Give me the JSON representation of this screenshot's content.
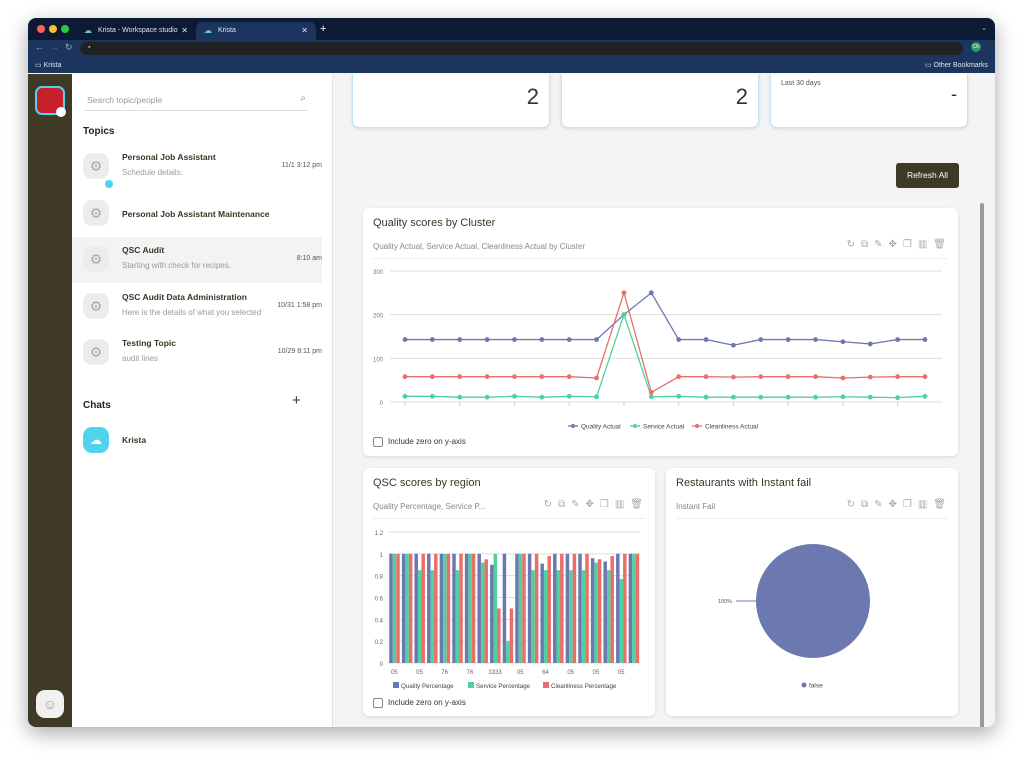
{
  "browser": {
    "tabs": [
      {
        "label": "Krista - Workspace studio"
      },
      {
        "label": "Krista"
      }
    ],
    "bookmark": "Krista",
    "other_bookmarks": "Other Bookmarks",
    "profile": "CK"
  },
  "sidebar": {
    "search_placeholder": "Search topic/people",
    "topics_heading": "Topics",
    "chats_heading": "Chats",
    "topics": [
      {
        "title": "Personal Job Assistant",
        "subtitle": "Schedule details:",
        "time": "11/1 3:12 pm",
        "unread": true
      },
      {
        "title": "Personal Job Assistant Maintenance",
        "subtitle": "",
        "time": ""
      },
      {
        "title": "QSC Audit",
        "subtitle": "Starting with check for recipes.",
        "time": "8:10 am",
        "selected": true
      },
      {
        "title": "QSC Audit Data Administration",
        "subtitle": "Here is the details of what you selected",
        "time": "10/31 1:58 pm"
      },
      {
        "title": "Testing Topic",
        "subtitle": "audit lines",
        "time": "10/29 8:11 pm"
      }
    ],
    "chats": [
      {
        "name": "Krista"
      }
    ]
  },
  "stats": [
    {
      "value": "2"
    },
    {
      "value": "2"
    },
    {
      "subtitle": "Last 30 days",
      "value": "-"
    }
  ],
  "refresh_label": "Refresh All",
  "include_zero_label": "Include zero on y-axis",
  "colors": {
    "quality": "#6c78b0",
    "service": "#4fd1a0",
    "cleanliness": "#e87068",
    "rail": "#3f3a25",
    "accent": "#4fd3ee"
  },
  "chart_data": [
    {
      "type": "line",
      "title": "Quality scores by Cluster",
      "subtitle": "Quality Actual, Service Actual, Cleanliness Actual by Cluster",
      "ylim": [
        0,
        300
      ],
      "yticks": [
        0,
        100,
        200,
        300
      ],
      "grid": true,
      "legend": "bottom",
      "series": [
        {
          "name": "Quality Actual",
          "values": [
            143,
            143,
            143,
            143,
            143,
            143,
            143,
            143,
            200,
            250,
            143,
            143,
            130,
            143,
            143,
            143,
            138,
            133,
            143,
            143
          ]
        },
        {
          "name": "Service Actual",
          "values": [
            13,
            13,
            11,
            11,
            13,
            11,
            13,
            12,
            200,
            12,
            13,
            11,
            11,
            11,
            11,
            11,
            12,
            11,
            10,
            13
          ]
        },
        {
          "name": "Cleanliness Actual",
          "values": [
            58,
            58,
            58,
            58,
            58,
            58,
            58,
            55,
            250,
            22,
            58,
            58,
            57,
            58,
            58,
            58,
            55,
            57,
            58,
            58
          ]
        }
      ]
    },
    {
      "type": "bar",
      "title": "QSC scores by region",
      "subtitle": "Quality Percentage, Service P...",
      "ylim": [
        0,
        1.2
      ],
      "yticks": [
        "0",
        "0.2",
        "0.4",
        "0.6",
        "0.8",
        "1",
        "1.2"
      ],
      "grid": true,
      "legend": "bottom",
      "categories": [
        "05",
        "",
        "05",
        "",
        "76",
        "",
        "76",
        "",
        "3333",
        "",
        "05",
        "",
        "64",
        "",
        "05",
        "",
        "05",
        "",
        "05",
        ""
      ],
      "series": [
        {
          "name": "Quality Percentage",
          "values": [
            1,
            1,
            1,
            1,
            1,
            1,
            1,
            1,
            0.9,
            1,
            1,
            1,
            0.91,
            1,
            1,
            1,
            0.96,
            0.93,
            1,
            1
          ]
        },
        {
          "name": "Service Percentage",
          "values": [
            1,
            1,
            0.85,
            0.85,
            1,
            0.85,
            1,
            0.92,
            1,
            0.2,
            1,
            0.85,
            0.85,
            0.85,
            0.85,
            0.85,
            0.92,
            0.85,
            0.77,
            1
          ]
        },
        {
          "name": "Cleanliness Percentage",
          "values": [
            1,
            1,
            1,
            1,
            1,
            1,
            1,
            0.95,
            0.5,
            0.5,
            1,
            1,
            0.98,
            1,
            1,
            1,
            0.95,
            0.98,
            1,
            1
          ]
        }
      ]
    },
    {
      "type": "pie",
      "title": "Restaurants with Instant fail",
      "subtitle": "Instant Fail",
      "slices": [
        {
          "name": "false",
          "value": 100,
          "label": "100%"
        }
      ],
      "legend": "bottom"
    }
  ]
}
